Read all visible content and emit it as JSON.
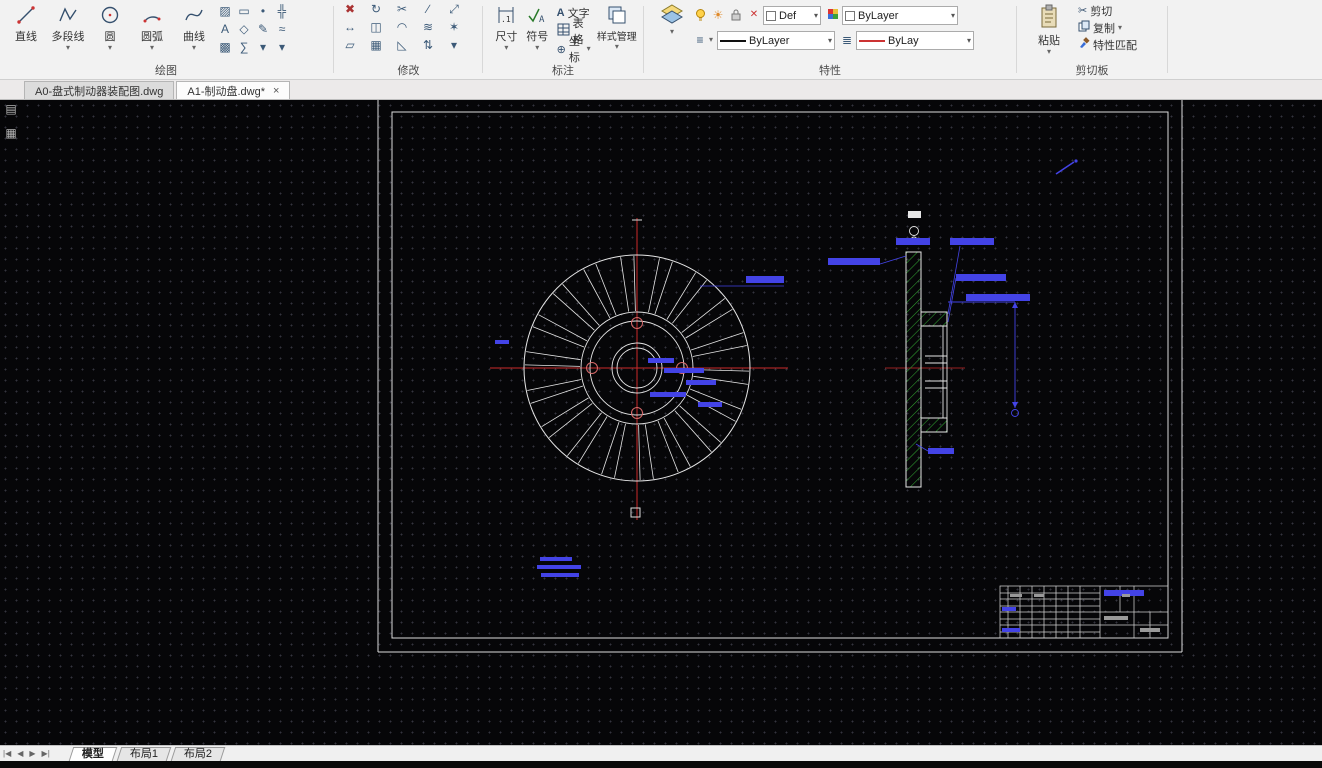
{
  "ribbon": {
    "draw": {
      "label": "绘图",
      "line": "直线",
      "polyline": "多段线",
      "circle": "圆",
      "arc": "圆弧",
      "spline": "曲线"
    },
    "modify": {
      "label": "修改"
    },
    "annotate": {
      "label": "标注",
      "dimension": "尺寸",
      "symbol": "符号",
      "text": "文字",
      "table": "表格",
      "coordinate": "坐标",
      "style_manager": "样式管理"
    },
    "properties": {
      "label": "特性",
      "layer_filter": "Def",
      "color": "ByLayer",
      "linetype": "ByLayer",
      "lineweight": "ByLay"
    },
    "clipboard": {
      "label": "剪切板",
      "paste": "粘贴",
      "cut": "剪切",
      "copy": "复制",
      "match_properties": "特性匹配"
    }
  },
  "doc_tabs": {
    "tab1": "A0-盘式制动器装配图.dwg",
    "tab2": "A1-制动盘.dwg*",
    "close": "×"
  },
  "layout_tabs": {
    "model": "模型",
    "layout1": "布局1",
    "layout2": "布局2"
  }
}
